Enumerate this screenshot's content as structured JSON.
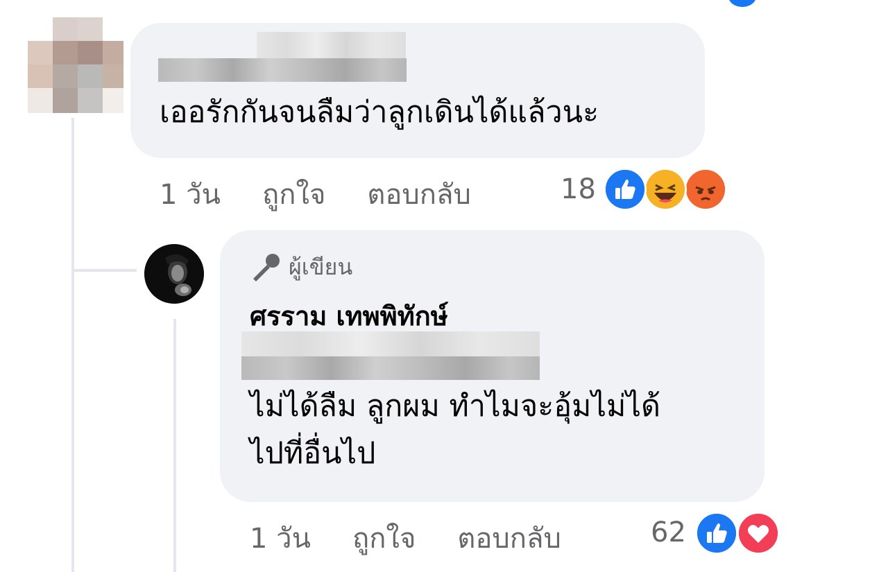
{
  "comment1": {
    "text": "เออรักกันจนลืมว่าลูกเดินได้แล้วนะ",
    "time": "1 วัน",
    "like_label": "ถูกใจ",
    "reply_label": "ตอบกลับ",
    "reaction_count": "18",
    "reactions": [
      "like-icon",
      "haha-icon",
      "angry-icon"
    ]
  },
  "reply1": {
    "badge": "ผู้เขียน",
    "author": "ศรราม เทพพิทักษ์",
    "text_line1": "ไม่ได้ลืม ลูกผม ทำไมจะอุ้มไม่ได้",
    "text_line2": "ไปที่อื่นไป",
    "time": "1 วัน",
    "like_label": "ถูกใจ",
    "reply_label": "ตอบกลับ",
    "reaction_count": "62",
    "reactions": [
      "like-icon",
      "love-icon"
    ]
  },
  "colors": {
    "bubble": "#f0f2f5",
    "meta_text": "#65676b",
    "like_blue": "#1877f2",
    "love_red": "#f33e58",
    "haha_yellow": "#f7b125"
  }
}
